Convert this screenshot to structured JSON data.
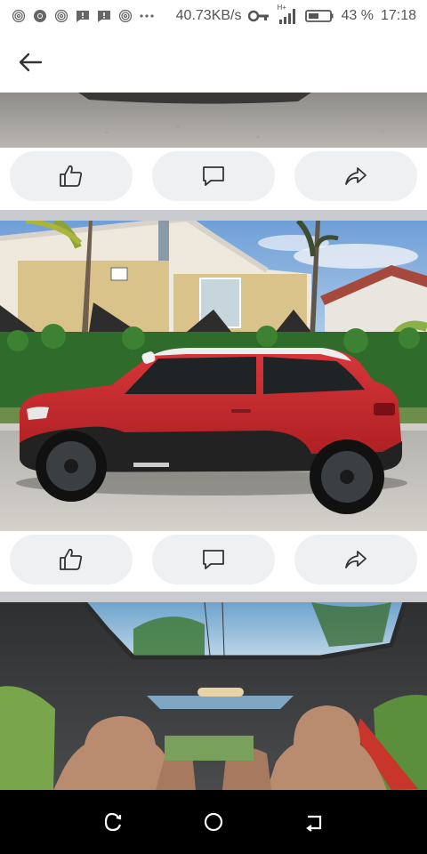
{
  "status_bar": {
    "left_icons": [
      "fingerprint-icon",
      "chrome-icon",
      "fingerprint-icon",
      "message-icon",
      "message-icon",
      "fingerprint-icon",
      "more-dots-icon"
    ],
    "network_speed": "40.73KB/s",
    "network_type": "H+",
    "battery_percent": "43 %",
    "time": "17:18"
  },
  "app_bar": {
    "back_icon": "arrow-left-icon"
  },
  "posts": [
    {
      "photo": "car-underside-photo",
      "actions": [
        "like",
        "comment",
        "share"
      ]
    },
    {
      "photo": "red-mini-paceman-photo",
      "actions": [
        "like",
        "comment",
        "share"
      ]
    },
    {
      "photo": "car-interior-sunroof-photo"
    }
  ],
  "nav_bar": [
    "recent-apps-icon",
    "home-icon",
    "back-icon"
  ],
  "colors": {
    "pill_bg": "#eef0f2",
    "separator": "#c9cbcf",
    "icon": "#333333",
    "car_red": "#c8262a"
  }
}
